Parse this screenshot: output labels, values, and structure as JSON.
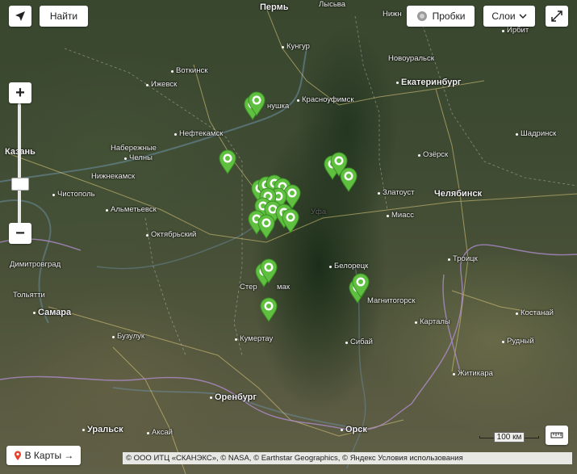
{
  "controls": {
    "find_label": "Найти",
    "traffic_label": "Пробки",
    "layers_label": "Слои",
    "to_maps_label": "В Карты →",
    "zoom_in": "+",
    "zoom_out": "−"
  },
  "scale_label": "100 км",
  "copyright": "© ООО ИТЦ «СКАНЭКС», © NASA, © Earthstar Geographics, © Яндекс Условия использования",
  "icons": [
    "locate-arrow-icon",
    "traffic-icon",
    "chevron-down-icon",
    "fullscreen-icon",
    "ruler-icon",
    "placemark-icon"
  ],
  "colors": {
    "marker_fill": "#5fbf3f",
    "marker_inner": "#ffffff",
    "marker_stroke": "#3b8f26",
    "button_bg": "#ffffff"
  },
  "cities": [
    {
      "name": "Пермь",
      "big": true
    },
    {
      "name": "Лысьва",
      "big": false
    },
    {
      "name": "Нижн",
      "big": false
    },
    {
      "name": "Ирбит",
      "big": false
    },
    {
      "name": "Кунгур",
      "big": false
    },
    {
      "name": "Новоуральск",
      "big": false
    },
    {
      "name": "Воткинск",
      "big": false
    },
    {
      "name": "Ижевск",
      "big": false
    },
    {
      "name": "Екатеринбург",
      "big": true
    },
    {
      "name": "нушка",
      "big": false
    },
    {
      "name": "Красноуфимск",
      "big": false
    },
    {
      "name": "Нефтекамск",
      "big": false
    },
    {
      "name": "Шадринск",
      "big": false
    },
    {
      "name": "Казань",
      "big": true
    },
    {
      "name": "Набережные",
      "big": false
    },
    {
      "name": "Челны",
      "big": false
    },
    {
      "name": "Озёрск",
      "big": false
    },
    {
      "name": "Нижнекамск",
      "big": false
    },
    {
      "name": "Чистополь",
      "big": false
    },
    {
      "name": "Златоуст",
      "big": false
    },
    {
      "name": "Челябинск",
      "big": true
    },
    {
      "name": "Альметьевск",
      "big": false
    },
    {
      "name": "Миасс",
      "big": false
    },
    {
      "name": "Октябрьский",
      "big": false
    },
    {
      "name": "Троицк",
      "big": false
    },
    {
      "name": "Димитровград",
      "big": false
    },
    {
      "name": "Белорецк",
      "big": false
    },
    {
      "name": "Тольятти",
      "big": false
    },
    {
      "name": "Стер",
      "big": false
    },
    {
      "name": "мак",
      "big": false
    },
    {
      "name": "Магнитогорск",
      "big": false
    },
    {
      "name": "Самара",
      "big": true
    },
    {
      "name": "Карталы",
      "big": false
    },
    {
      "name": "Костанай",
      "big": false
    },
    {
      "name": "Бузулук",
      "big": false
    },
    {
      "name": "Кумертау",
      "big": false
    },
    {
      "name": "Сибай",
      "big": false
    },
    {
      "name": "Рудный",
      "big": false
    },
    {
      "name": "Житикара",
      "big": false
    },
    {
      "name": "Оренбург",
      "big": true
    },
    {
      "name": "Уральск",
      "big": true
    },
    {
      "name": "Аксай",
      "big": false
    },
    {
      "name": "Орск",
      "big": true
    }
  ],
  "faint_labels": [
    "Уфа"
  ],
  "marker_count": 24
}
